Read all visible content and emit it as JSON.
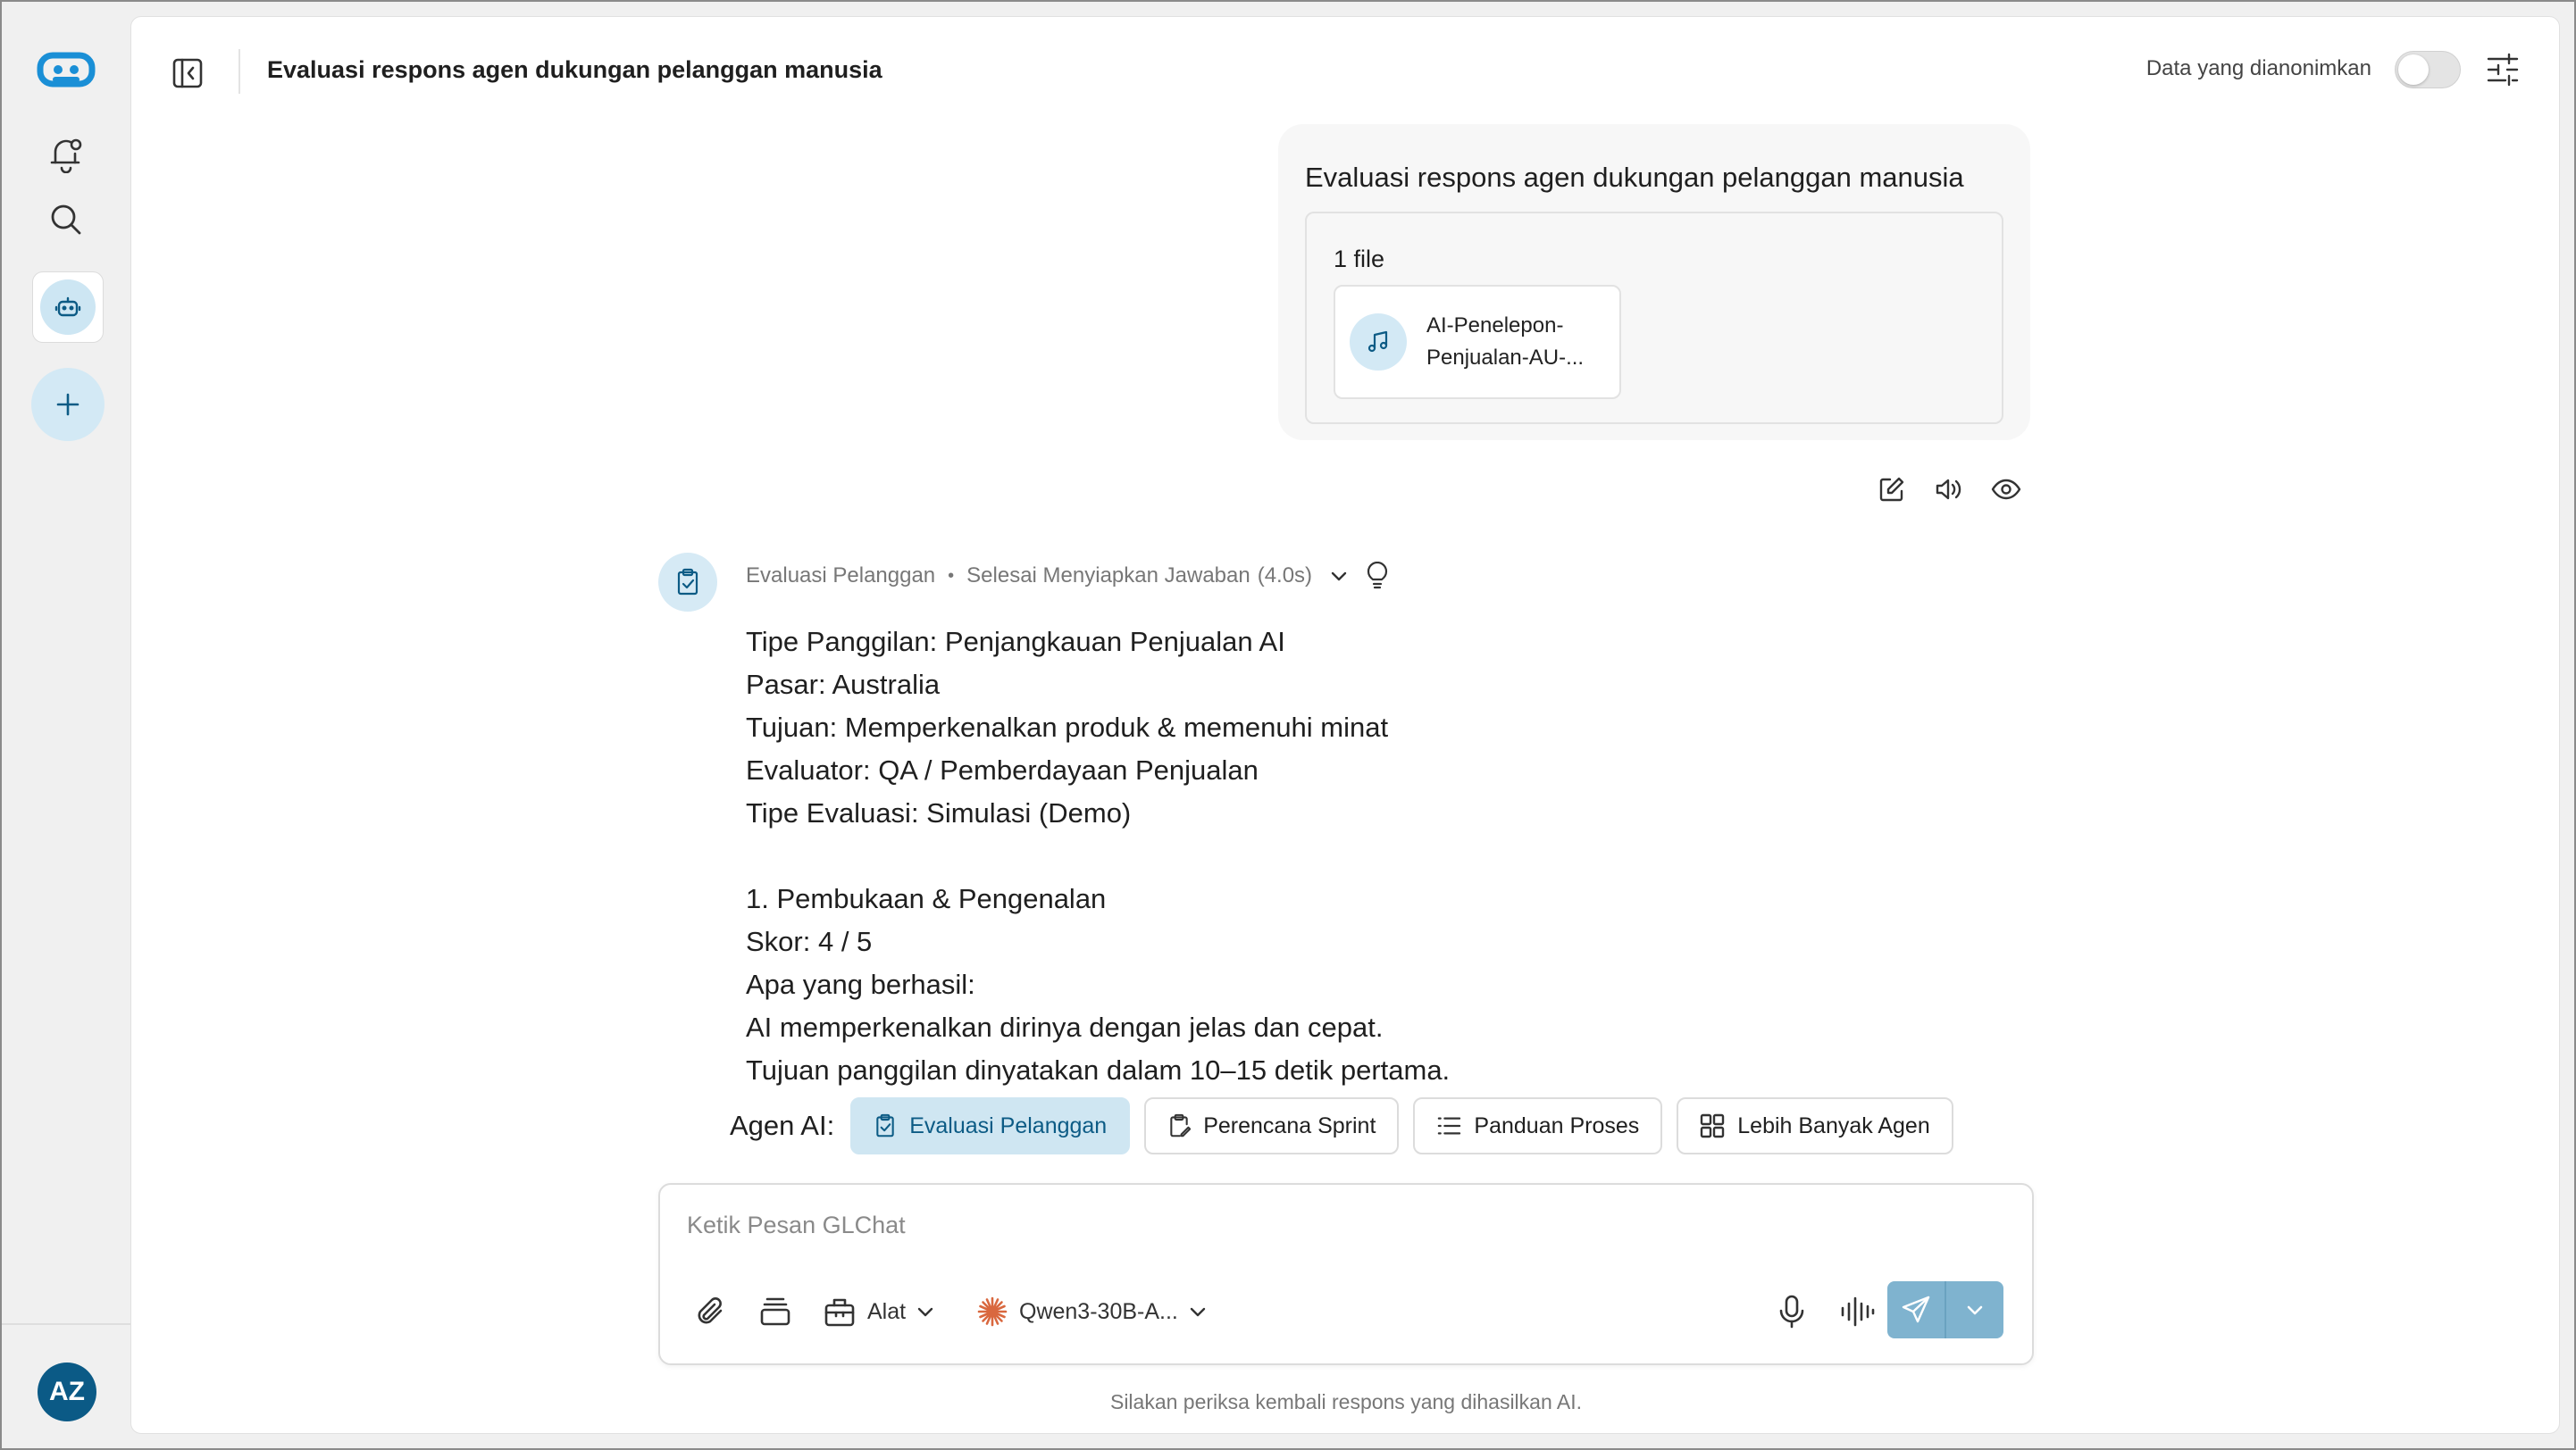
{
  "app": {
    "title": "Evaluasi respons agen dukungan pelanggan manusia",
    "anonymized_label": "Data yang dianonimkan",
    "anonymized_on": false,
    "accent": "#0c5b85"
  },
  "sidebar": {
    "icons": [
      "logo-icon",
      "notification-bell-icon",
      "search-icon",
      "agent-icon",
      "plus-icon"
    ],
    "avatar_initials": "AZ"
  },
  "user_message": {
    "text": "Evaluasi respons agen dukungan pelanggan manusia",
    "files_label": "1 file",
    "file_name": "AI-Penelepon-Penjualan-AU-...",
    "file_icon": "music-file-icon"
  },
  "assistant": {
    "agent_name": "Evaluasi Pelanggan",
    "status": "Selesai Menyiapkan Jawaban",
    "duration": "(4.0s)",
    "lines": [
      "Tipe Panggilan: Penjangkauan Penjualan AI",
      "Pasar: Australia",
      "Tujuan: Memperkenalkan produk & memenuhi minat",
      "Evaluator: QA / Pemberdayaan Penjualan",
      "Tipe Evaluasi: Simulasi (Demo)",
      "",
      "1. Pembukaan & Pengenalan",
      "Skor: 4 / 5",
      "Apa yang berhasil:",
      "AI memperkenalkan dirinya dengan jelas dan cepat.",
      "Tujuan panggilan dinyatakan dalam 10–15 detik pertama."
    ]
  },
  "agents": {
    "label": "Agen AI:",
    "chips": [
      "Evaluasi Pelanggan",
      "Perencana Sprint",
      "Panduan Proses",
      "Lebih Banyak Agen"
    ]
  },
  "composer": {
    "placeholder": "Ketik Pesan GLChat",
    "tools_label": "Alat",
    "model": "Qwen3-30B-A..."
  },
  "disclaimer": "Silakan periksa kembali respons yang dihasilkan AI."
}
